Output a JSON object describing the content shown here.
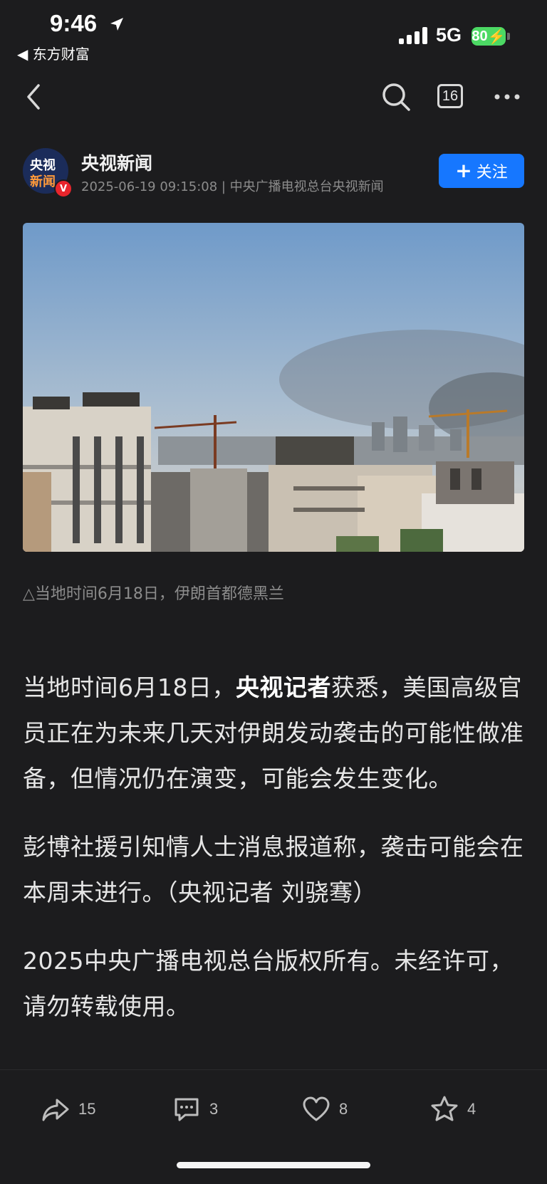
{
  "status_bar": {
    "time": "9:46",
    "back_app": "◀ 东方财富",
    "network": "5G",
    "battery": "80"
  },
  "nav": {
    "comment_count": "16"
  },
  "author": {
    "avatar_line1": "央视",
    "avatar_line2": "新闻",
    "badge": "V",
    "name": "央视新闻",
    "meta": "2025-06-19 09:15:08 | 中央广播电视总台央视新闻",
    "follow_label": "关注"
  },
  "image_caption": "△当地时间6月18日，伊朗首都德黑兰",
  "article": {
    "p1_before": "当地时间6月18日，",
    "p1_bold": "央视记者",
    "p1_after": "获悉，美国高级官员正在为未来几天对伊朗发动袭击的可能性做准备，但情况仍在演变，可能会发生变化。",
    "p2": "彭博社援引知情人士消息报道称，袭击可能会在本周末进行。（央视记者 刘骁骞）",
    "p3": "2025中央广播电视总台版权所有。未经许可，请勿转载使用。"
  },
  "bottom_bar": {
    "share_count": "15",
    "comment_count": "3",
    "like_count": "8",
    "favorite_count": "4"
  },
  "colors": {
    "background": "#1c1c1e",
    "accent": "#1677ff",
    "battery": "#4cd964"
  }
}
